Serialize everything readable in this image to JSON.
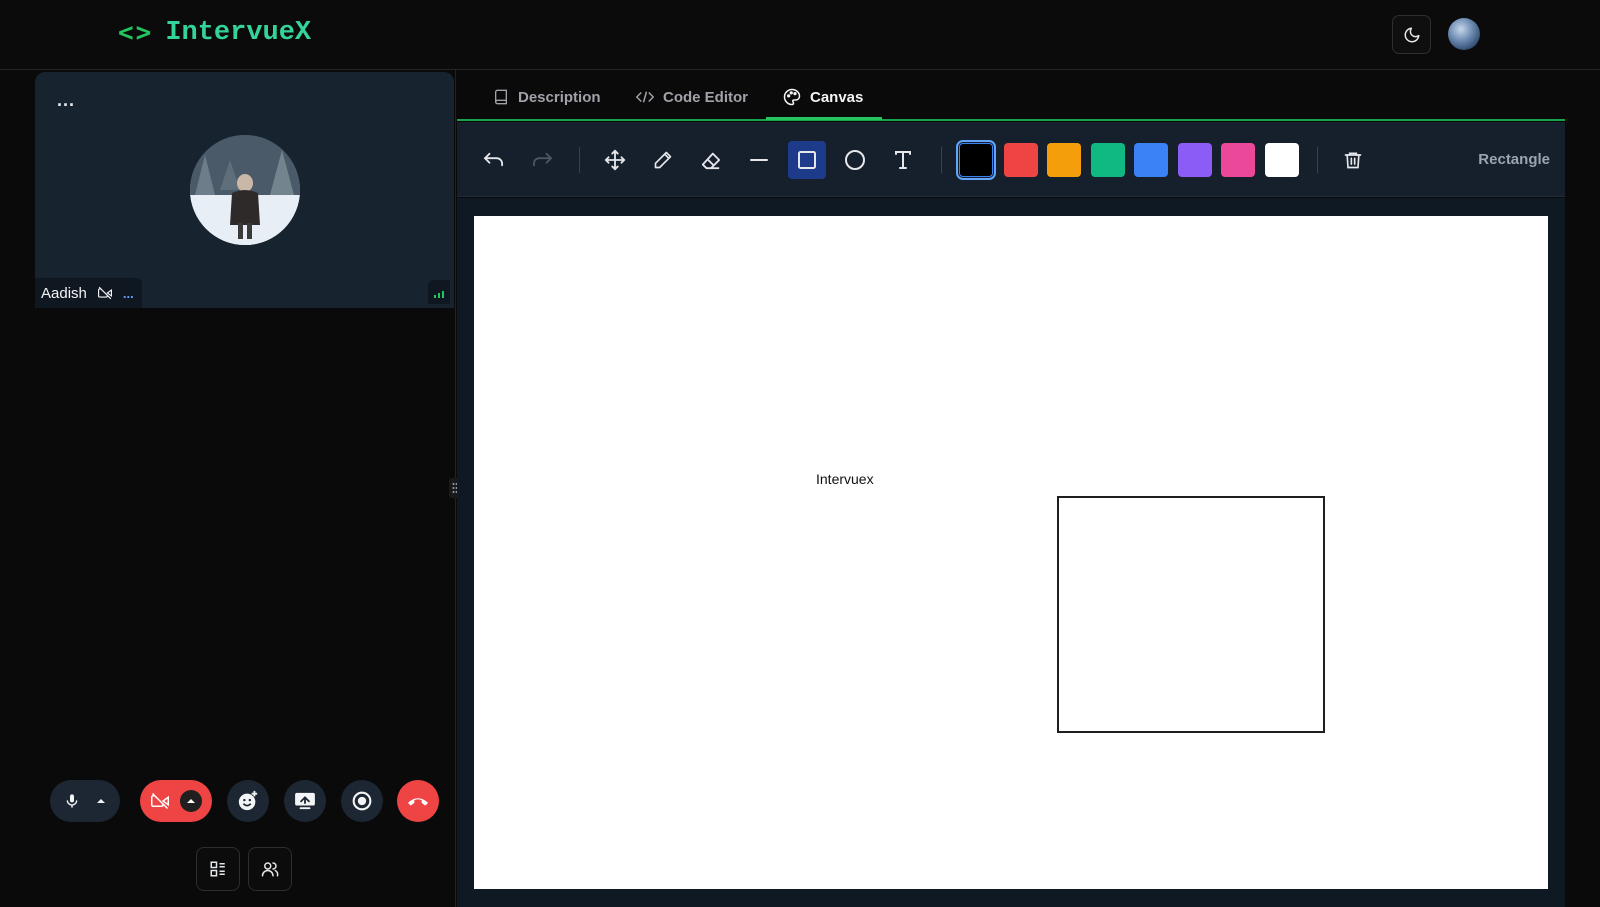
{
  "header": {
    "logo_icon": "<>",
    "logo_text": "IntervueX",
    "theme_icon": "moon-icon"
  },
  "participant": {
    "name": "Aadish",
    "menu": "...",
    "status_dots": "...",
    "camera_status_icon": "camera-off-icon"
  },
  "tabs": [
    {
      "label": "Description",
      "icon": "book-icon",
      "active": false
    },
    {
      "label": "Code Editor",
      "icon": "code-icon",
      "active": false
    },
    {
      "label": "Canvas",
      "icon": "palette-icon",
      "active": true
    }
  ],
  "toolbar": {
    "tools": [
      "undo",
      "redo",
      "move",
      "pencil",
      "eraser",
      "line",
      "rectangle",
      "circle",
      "text"
    ],
    "selected_tool": "rectangle",
    "selected_tool_label": "Rectangle",
    "colors": [
      "#000000",
      "#ef4444",
      "#f59e0b",
      "#10b981",
      "#3b82f6",
      "#8b5cf6",
      "#ec4899",
      "#ffffff"
    ],
    "selected_color": "#000000"
  },
  "canvas": {
    "text_items": [
      {
        "text": "Intervuex"
      }
    ]
  },
  "controls": [
    "microphone",
    "camera-off",
    "reactions",
    "share-screen",
    "record",
    "end-call",
    "layout",
    "participants"
  ]
}
